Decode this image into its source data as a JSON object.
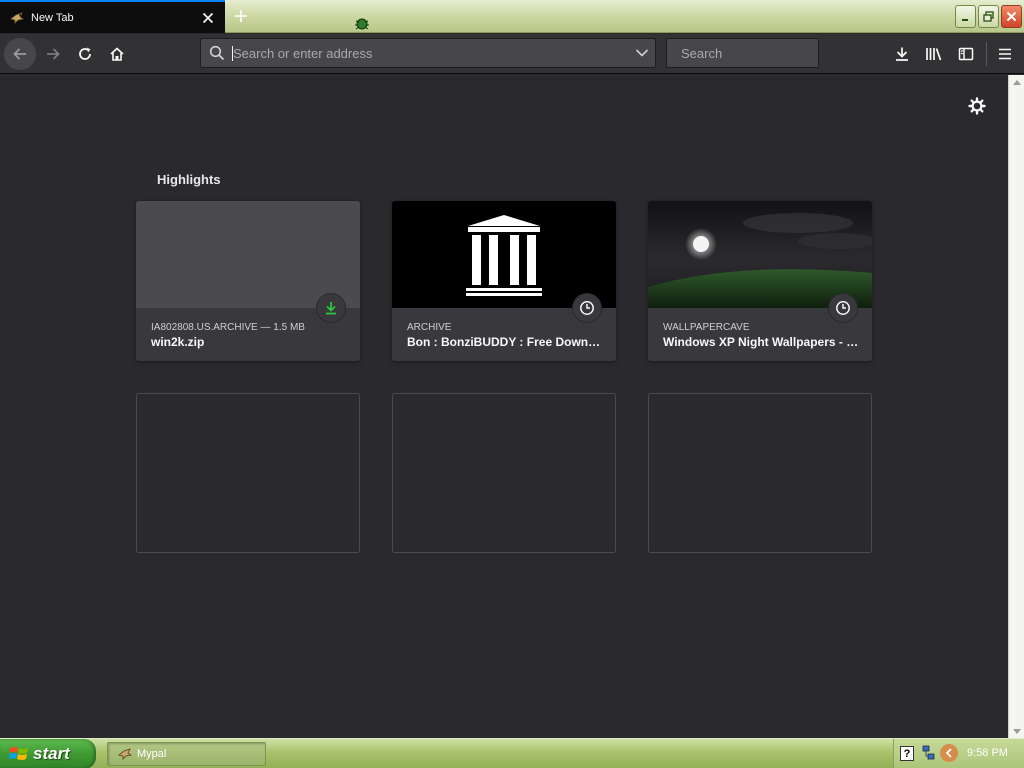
{
  "browser": {
    "tab": {
      "title": "New Tab"
    },
    "urlbar": {
      "placeholder": "Search or enter address"
    },
    "searchbar": {
      "placeholder": "Search"
    }
  },
  "newtab": {
    "section_title": "Highlights",
    "cards": [
      {
        "source": "IA802808.US.ARCHIVE — 1.5 MB",
        "title": "win2k.zip",
        "badge": "download-icon"
      },
      {
        "source": "ARCHIVE",
        "title": "Bon : BonziBUDDY : Free Download, Borrow, and Streaming : Internet Archive",
        "badge": "clock-icon"
      },
      {
        "source": "WALLPAPERCAVE",
        "title": "Windows XP Night Wallpapers - Wallpaper Cave",
        "badge": "clock-icon"
      }
    ]
  },
  "taskbar": {
    "start_label": "start",
    "task_item": "Mypal",
    "tray_help": "?",
    "clock": "9:58 PM"
  },
  "colors": {
    "accent": "#0a84ff",
    "page_background": "#2a2a2e",
    "toolbar": "#323234",
    "download_green": "#2ac93c"
  }
}
